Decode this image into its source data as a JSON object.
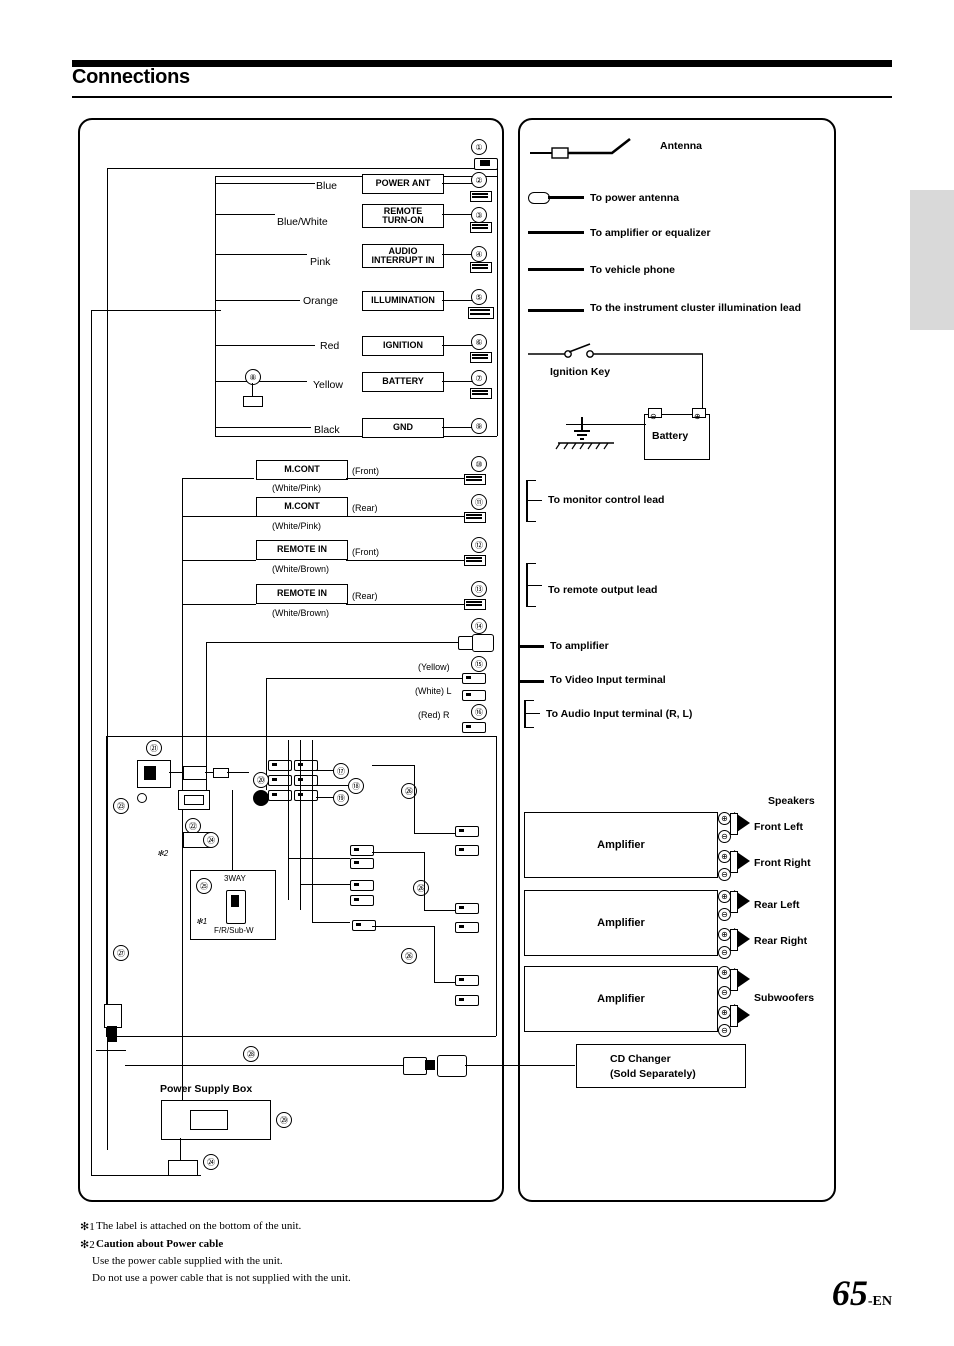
{
  "header": {
    "title": "Connections"
  },
  "page": {
    "number": "65",
    "suffix": "-EN"
  },
  "left_panel": {
    "wires": [
      {
        "color_label": "Blue",
        "box": "POWER ANT",
        "num": "2"
      },
      {
        "color_label": "Blue/White",
        "box": "REMOTE\nTURN-ON",
        "num": "3"
      },
      {
        "color_label": "Pink",
        "box": "AUDIO\nINTERRUPT IN",
        "num": "4"
      },
      {
        "color_label": "Orange",
        "box": "ILLUMINATION",
        "num": "5"
      },
      {
        "color_label": "Red",
        "box": "IGNITION",
        "num": "6"
      },
      {
        "color_label": "Yellow",
        "box": "BATTERY",
        "num": "7"
      },
      {
        "color_label": "Black",
        "box": "GND",
        "num": "9"
      }
    ],
    "top_num": "1",
    "battery_side_num": "8",
    "cont_rows": [
      {
        "box": "M.CONT",
        "pos": "(Front)",
        "sub": "(White/Pink)",
        "num": "10"
      },
      {
        "box": "M.CONT",
        "pos": "(Rear)",
        "sub": "(White/Pink)",
        "num": "11"
      },
      {
        "box": "REMOTE IN",
        "pos": "(Front)",
        "sub": "(White/Brown)",
        "num": "12"
      },
      {
        "box": "REMOTE IN",
        "pos": "(Rear)",
        "sub": "(White/Brown)",
        "num": "13"
      }
    ],
    "amp_num": "14",
    "video_label": "(Yellow)",
    "video_num": "15",
    "audio_l_label": "(White) L",
    "audio_r_label": "(Red) R",
    "audio_num": "16",
    "callouts": [
      "17",
      "18",
      "19",
      "20",
      "21",
      "22",
      "23",
      "24",
      "25",
      "26",
      "26",
      "26",
      "27",
      "28",
      "29",
      "24"
    ],
    "switch_label_top": "3WAY",
    "switch_label_bottom": "F/R/Sub-W",
    "asterisk1": "✻1",
    "asterisk2": "✻2",
    "power_supply_box": "Power Supply Box"
  },
  "right_panel": {
    "antenna": "Antenna",
    "items": [
      "To power antenna",
      "To amplifier or equalizer",
      "To vehicle phone",
      "To the instrument cluster illumination lead"
    ],
    "ignition_key": "Ignition Key",
    "battery": "Battery",
    "monitor_control": "To monitor control  lead",
    "remote_output": "To remote output lead",
    "to_amplifier": "To amplifier",
    "to_video": "To Video Input terminal",
    "to_audio": "To Audio Input terminal (R, L)",
    "speakers_title": "Speakers",
    "speaker_labels": [
      "Front Left",
      "Front Right",
      "Rear Left",
      "Rear Right",
      "Subwoofers"
    ],
    "amplifiers": [
      "Amplifier",
      "Amplifier",
      "Amplifier"
    ],
    "cd_changer": "CD Changer\n(Sold Separately)",
    "cd_changer_line1": "CD Changer",
    "cd_changer_line2": "(Sold Separately)"
  },
  "footnotes": {
    "n1_mark": "✻1",
    "n1": "The label is attached on the bottom of the unit.",
    "n2_mark": "✻2",
    "n2_title": "Caution about Power cable",
    "n2_line1": "Use the power cable supplied with the unit.",
    "n2_line2": "Do not use a power cable that is not supplied with the unit."
  }
}
